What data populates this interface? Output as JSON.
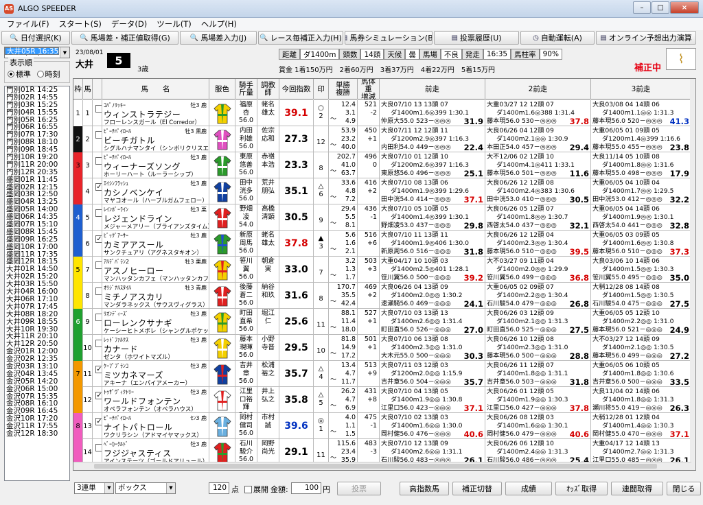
{
  "window": {
    "title": "ALGO SPEEDER",
    "controls": [
      "–",
      "□",
      "×"
    ]
  },
  "menu": [
    "ファイル(F)",
    "スタート(S)",
    "データ(D)",
    "ツール(T)",
    "ヘルプ(H)"
  ],
  "toolbar": [
    {
      "label": "日付選択(K)",
      "icon": "magnifier-icon",
      "w": 100
    },
    {
      "label": "馬場差・補正値取得(G)",
      "icon": "magnifier-icon",
      "w": 156
    },
    {
      "label": "馬場差入力(J)",
      "icon": "magnifier-icon",
      "w": 112
    },
    {
      "label": "レース毎補正入力(H)",
      "icon": "magnifier-icon",
      "w": 124
    },
    {
      "label": "馬券シミュレーション(B)",
      "icon": "sheet-icon",
      "w": 128
    },
    {
      "label": "投票履歴(U)",
      "icon": "sheet-icon",
      "w": 124
    },
    {
      "label": "自動運転(A)",
      "icon": "clock-icon",
      "w": 108
    },
    {
      "label": "オンライン予想出力演算",
      "icon": "sheet-icon",
      "w": 146
    }
  ],
  "left": {
    "date": "2023/08/01",
    "order_label": "表示順",
    "order_options": [
      "標準",
      "時刻"
    ],
    "order_selected": 0,
    "races": [
      "門別01R 14:25",
      "門別02R 14:55",
      "門別03R 15:25",
      "門別04R 15:55",
      "門別05R 16:25",
      "門別06R 16:55",
      "門別07R 17:30",
      "門別08R 18:10",
      "門別09R 18:45",
      "門別10R 19:20",
      "門別11R 20:00",
      "門別12R 20:35",
      "盛岡01R 11:45",
      "盛岡02R 12:15",
      "盛岡03R 12:50",
      "盛岡04R 13:25",
      "盛岡05R 14:00",
      "盛岡06R 14:35",
      "盛岡07R 15:10",
      "盛岡08R 15:45",
      "盛岡09R 16:25",
      "盛岡10R 17:00",
      "盛岡11R 17:35",
      "盛岡12R 18:15",
      "大井01R 14:50",
      "大井02R 15:20",
      "大井03R 15:50",
      "大井04R 16:00",
      "大井05R 16:35",
      "大井06R 17:10",
      "大井07R 17:45",
      "大井08R 18:20",
      "大井09R 18:55",
      "大井10R 19:30",
      "大井11R 20:10",
      "大井12R 20:50",
      "金沢01R 12:00",
      "金沢02R 12:35",
      "金沢03R 13:10",
      "金沢04R 13:45",
      "金沢05R 14:20",
      "金沢06R 15:00",
      "金沢07R 15:35",
      "金沢08R 16:10",
      "金沢09R 16:45",
      "金沢10R 17:20",
      "金沢11R 17:55",
      "金沢12R 18:30"
    ],
    "selected_index": 28
  },
  "header": {
    "date": "23/08/01",
    "venue": "大井",
    "race_no": "5",
    "category": "3歳",
    "info": [
      [
        "距離",
        "lab"
      ],
      [
        "ダ1400m",
        ""
      ],
      [
        "頭数",
        "lab"
      ],
      [
        "14頭",
        ""
      ],
      [
        "天候",
        "lab"
      ],
      [
        "曇",
        ""
      ],
      [
        "馬場",
        "lab"
      ],
      [
        "不良",
        ""
      ],
      [
        "発走",
        "lab"
      ],
      [
        "16:35",
        ""
      ],
      [
        "馬柱率",
        "lab"
      ],
      [
        "90%",
        ""
      ]
    ],
    "prizes": "賞金 1着150万円　2着60万円　3着37万円　4着22万円　5着15万円",
    "status": "補正中"
  },
  "columns": [
    "枠",
    "馬",
    "",
    "馬　　名",
    "服色",
    "騎手\n斤量",
    "調教\n師",
    "今回指数",
    "印",
    "単勝\n複勝",
    "馬体重\n増減",
    "前走",
    "2前走",
    "3前走"
  ],
  "waku_colors": [
    "#ffffff",
    "#111111",
    "#e8242a",
    "#e8242a",
    "#1f5fcf",
    "#1f5fcf",
    "#ffe500",
    "#ffe500",
    "#20a030",
    "#20a030",
    "#f39800",
    "#f39800",
    "#f05cbe",
    "#f05cbe"
  ],
  "waku_text_colors": [
    "#000",
    "#fff",
    "#000",
    "#000",
    "#fff",
    "#fff",
    "#000",
    "#000",
    "#fff",
    "#fff",
    "#000",
    "#000",
    "#000",
    "#000"
  ],
  "waku_labels": [
    "1",
    "2",
    "3",
    "",
    "4",
    "",
    "5",
    "",
    "6",
    "",
    "7",
    "",
    "8",
    ""
  ],
  "horses": [
    {
      "no": "1",
      "chk": false,
      "sire": "ｺﾊﾟﾉﾘｯｷｰ",
      "sex": "牡3 鹿",
      "name": "ウィンストラテジー",
      "dam": "フローレンスガール（El Corredor）",
      "jockey": "福原\n杏\n56.0",
      "trainer": "蛯名\n雄太",
      "index": "39.1",
      "index_color": "red",
      "mark": "○\n2",
      "odds": "12.4\n3.1\n4.9",
      "wt": "521\n-2",
      "p1": [
        "大良07/10 13 13頭 07",
        "ダ1400m1.6◎399 1:30.1",
        "仲原大55.0 523－◎◎◎ 31.9"
      ],
      "p2": [
        "大重03/27 12 12頭 07",
        "ダ1400m1.6◎388 1:31.4",
        "藤本現56.0 530－◎◎◎ 37.8"
      ],
      "p3": [
        "大良03/08 04 14頭 06",
        "ダ1400m1.1◎◎ 1:31.3",
        "藤本現56.0 520－◎◎◎ 41.3"
      ],
      "p2c": "red",
      "p3c": "blue"
    },
    {
      "no": "2",
      "chk": false,
      "sire": "ﾋﾟｰﾁﾊﾟｲﾛｰﾙ",
      "sex": "牡3 黒鹿",
      "name": "ビーチガトル",
      "dam": "シグルハナマンタイ（シンボリクリスエス）",
      "jockey": "内田\n利雄\n56.0",
      "trainer": "佐宗\n応和",
      "index": "27.3",
      "index_color": "",
      "mark": "\n12",
      "odds": "53.9\n23.2\n40.0",
      "wt": "450\n+1",
      "p1": [
        "大良07/11 12 12頭 11",
        "ダ1200m2.9◎397 1:16.3",
        "内田利54.0 449－◎◎◎ 22.4"
      ],
      "p2": [
        "大良06/26 04 12頭 09",
        "ダ1400m2.1◎◎ 1:30.9",
        "本田正54.0 457－◎◎◎ 29.4"
      ],
      "p3": [
        "大重06/05 01 09頭 05",
        "ダ1200m1.4◎399 1:16.6",
        "藤本現55.0 455－◎◎◎ 23.8"
      ],
      "p2c": "",
      "p3c": ""
    },
    {
      "no": "3",
      "chk": false,
      "sire": "ﾋﾟｰﾁﾊﾟｲﾛｰﾙ",
      "sex": "牡3 鹿",
      "name": "ウィーナーズソング",
      "dam": "ホーリーハート（ルーラーシップ）",
      "jockey": "東原\n悠善\n56.0",
      "trainer": "赤嶺\n本浩",
      "index": "23.3",
      "index_color": "",
      "mark": "\n8",
      "odds": "202.7\n41.0\n63.7",
      "wt": "496\n0",
      "p1": [
        "大良07/10 01 12頭 10",
        "ダ1200m2.6◎397 1:16.3",
        "東原悠56.0 496－◎◎◎ 25.1"
      ],
      "p2": [
        "大不12/06 02 12頭 10",
        "ダ1400m4.1◎411 1:33.1",
        "藤本現56.0 501－◎◎◎ 11.6"
      ],
      "p3": [
        "大良11/14 05 10頭 08",
        "ダ1400m1.8◎◎ 1:31.6",
        "藤本現55.0 498－◎◎◎ 17.9"
      ],
      "p2c": "",
      "p3c": ""
    },
    {
      "no": "4",
      "chk": true,
      "sire": "ｴｲｼﾝﾌﾗｯｼｭ",
      "sex": "牡3 鹿",
      "name": "カシノベンケイ",
      "dam": "マヤコオール（ハーブルガムフェロー）",
      "jockey": "田中\n洸多\n56.0",
      "trainer": "荒井\n朋弘",
      "index": "35.1",
      "index_color": "",
      "mark": "△\n6",
      "odds": "33.6\n4.8\n7.2",
      "wt": "416\n+2",
      "p1": [
        "大良07/10 08 13頭 06",
        "ダ1400m1.9◎399 1:29.6",
        "田中洸54.0 414－◎◎◎ 37.1"
      ],
      "p2": [
        "大良06/26 12 12頭 08",
        "ダ1400m2.4◎383 1:30.6",
        "田中洸53.0 410－◎◎◎ 30.5"
      ],
      "p3": [
        "大重06/05 04 10頭 04",
        "ダ1400m1.7◎◎ 1:29.5",
        "田中洸53.0 412－◎◎◎ 32.2"
      ],
      "p1c": "red",
      "p2c": "",
      "p3c": ""
    },
    {
      "no": "5",
      "chk": false,
      "sire": "ﾚｲﾝﾎﾞｰﾗｲﾝ",
      "sex": "牡3 栗",
      "name": "レジェンドライン",
      "dam": "メジャーメアリー（ブライアンズタイム）",
      "jockey": "野畑\n凌\n54.0",
      "trainer": "高橋\n清顕",
      "index": "30.5",
      "index_color": "",
      "mark": "\n9",
      "odds": "29.4\n5.5\n8.1",
      "wt": "436\n-1",
      "p1": [
        "大良07/10 05 10頭 05",
        "ダ1400m1.4◎399 1:30.1",
        "野畑凌53.0 437－◎◎◎ 29.8"
      ],
      "p2": [
        "大良06/26 05 12頭 07",
        "ダ1400m1.8◎◎ 1:30.7",
        "西啓太54.0 437－◎◎◎ 32.1"
      ],
      "p3": [
        "大重06/05 04 14頭 06",
        "ダ1400m1.9◎◎ 1:30.1",
        "西啓太54.0 441－◎◎◎ 32.8"
      ],
      "p2c": "",
      "p3c": ""
    },
    {
      "no": "6",
      "chk": true,
      "sire": "ﾋﾞｯｸﾞｱｰｻｰ",
      "sex": "牡3 鹿",
      "name": "カミアアスール",
      "dam": "サンクチュアリ（アグネスタキオン）",
      "jockey": "新原\n周馬\n56.0",
      "trainer": "蛯名\n雄太",
      "index": "37.8",
      "index_color": "red",
      "mark": "▲\n3",
      "odds": "5.6\n1.6\n2.1",
      "wt": "516\n+6",
      "p1": [
        "大良07/10 11 13頭 11",
        "ダ1400m1.9◎406 1:30.0",
        "新原周56.0 516－◎◎◎ 31.8"
      ],
      "p2": [
        "大良06/26 12 12頭 04",
        "ダ1400m2.3◎◎ 1:30.4",
        "藤本現56.0 510－◎◎◎ 39.5"
      ],
      "p3": [
        "大重06/05 03 09頭 05",
        "ダ1400m1.6◎◎ 1:30.8",
        "藤本現56.0 510－◎◎◎ 37.3"
      ],
      "p2c": "red",
      "p3c": "red"
    },
    {
      "no": "7",
      "chk": false,
      "sire": "ｱﾙﾃﾞﾊﾞﾗﾝ2",
      "sex": "牡3 栗鹿",
      "name": "アスノヒーロー",
      "dam": "マンハッタンカフェ（マンハッタンカフェ）",
      "jockey": "笹川\n翼\n56.0",
      "trainer": "朝倉\n実",
      "index": "33.0",
      "index_color": "",
      "mark": "\n7",
      "odds": "3.2\n1.3\n1.7",
      "wt": "503\n+3",
      "p1": [
        "大重04/17 10 10頭 03",
        "ダ1400m2.5◎401 1:28.1",
        "笹川翼56.0 500－◎◎◎ 39.2"
      ],
      "p2": [
        "大不03/27 09 11頭 04",
        "ダ1400m2.0◎◎ 1:29.9",
        "笹川翼56.0 499－◎◎◎ 36.8"
      ],
      "p3": [
        "大良03/06 10 14頭 06",
        "ダ1400m1.5◎◎ 1:30.3",
        "笹川翼55.0 495－◎◎◎ 35.0"
      ],
      "p1c": "red",
      "p2c": "red",
      "p3c": ""
    },
    {
      "no": "8",
      "chk": false,
      "sire": "ｵﾘｼﾞﾅﾙｽﾀｲﾙ",
      "sex": "牡3 青鹿",
      "name": "ミチノアスカリ",
      "dam": "マンダラネックス（サウスヴィグラス）",
      "jockey": "後藤\n蒼二\n56.0",
      "trainer": "納谷\n和玖",
      "index": "31.6",
      "index_color": "",
      "mark": "\n8",
      "odds": "170.7\n35.5\n42.4",
      "wt": "469\n+2",
      "p1": [
        "大良06/26 04 13頭 09",
        "ダ1400m2.0◎◎ 1:30.2",
        "速瀬騎56.0 469－◎◎◎ 24.1"
      ],
      "p2": [
        "大重06/05 02 09頭 07",
        "ダ1400m2.2◎◎ 1:30.4",
        "石川駿54.0 479－◎◎◎ 26.8"
      ],
      "p3": [
        "大稍12/28 08 14頭 08",
        "ダ1400m1.5◎◎ 1:30.5",
        "石川駿54.0 475－◎◎◎ 27.5"
      ],
      "p2c": "",
      "p3c": ""
    },
    {
      "no": "9",
      "chk": false,
      "sire": "ﾘｵﾝﾃﾞｨｰｽﾞ",
      "sex": "牡3 鹿",
      "name": "ローレンクサナギ",
      "dam": "ケーシーヒトメボレ（シャングルポケット）",
      "jockey": "町田\n直希\n56.0",
      "trainer": "堀江\n仁",
      "index": "25.6",
      "index_color": "",
      "mark": "\n11",
      "odds": "88.1\n11.4\n18.0",
      "wt": "527\n+1",
      "p1": [
        "大良07/10 03 13頭 13",
        "ダ1400m2.6◎◎ 1:31.4",
        "町田直56.0 526－◎◎◎ 27.0"
      ],
      "p2": [
        "大良06/26 03 12頭 09",
        "ダ1400m2.1◎◎ 1:31.3",
        "町田直56.0 525－◎◎◎ 27.5"
      ],
      "p3": [
        "大重06/05 05 12頭 10",
        "ダ1400m2.2◎◎ 1:31.0",
        "藤本現56.0 521－◎◎◎ 24.9"
      ],
      "p2c": "",
      "p3c": ""
    },
    {
      "no": "10",
      "chk": false,
      "sire": "ﾚｯﾄﾞﾌｧﾙｸｽ",
      "sex": "牡3 鹿",
      "name": "カナード",
      "dam": "ゼンタ（ホワイトマズル）",
      "jockey": "藤本\n現暉\n56.0",
      "trainer": "小野\n寺晋",
      "index": "29.5",
      "index_color": "",
      "mark": "\n10",
      "odds": "81.8\n14.9\n17.2",
      "wt": "501\n+1",
      "p1": [
        "大良07/10 06 13頭 08",
        "ダ1400m2.3◎◎ 1:31.0",
        "大木元55.0 500－◎◎◎ 30.3"
      ],
      "p2": [
        "大良06/26 10 12頭 08",
        "ダ1400m2.3◎◎ 1:31.0",
        "藤本現56.0 500－◎◎◎ 28.8"
      ],
      "p3": [
        "大不03/27 12 14頭 09",
        "ダ1400m2.1◎◎ 1:30.5",
        "藤本現56.0 499－◎◎◎ 27.2"
      ],
      "p2c": "",
      "p3c": ""
    },
    {
      "no": "11",
      "chk": true,
      "sire": "ｹｰﾌﾟﾌﾞﾗﾝｺ",
      "sex": "牡3 鹿",
      "name": "ミツカネマーズ",
      "dam": "アキーナ（エンパイアメーカー）",
      "jockey": "吉井\n章\n56.0",
      "trainer": "松浦\n裕之",
      "index": "35.7",
      "index_color": "",
      "mark": "△\n4",
      "odds": "13.4\n4.7\n11.7",
      "wt": "513\n+9",
      "p1": [
        "大良07/11 03 12頭 03",
        "ダ1200m2.0◎◎ 1:15.9",
        "吉井章56.0 504－◎◎◎ 35.7"
      ],
      "p2": [
        "大良06/26 11 12頭 07",
        "ダ1400m1.8◎◎ 1:31.1",
        "吉井章56.0 503－◎◎◎ 31.8"
      ],
      "p3": [
        "大重06/05 06 10頭 05",
        "ダ1400m1.8◎◎ 1:30.6",
        "吉井章56.0 500－◎◎◎ 33.5"
      ],
      "p2c": "",
      "p3c": ""
    },
    {
      "no": "12",
      "chk": true,
      "sire": "ﾄｩｻﾞｳﾞｨｸﾄﾘｰ",
      "sex": "牡3 鹿",
      "name": "ワールドフォンテン",
      "dam": "オペラフォンテン（オペラハウス）",
      "jockey": "江里\n口裕\n輝\n56.0",
      "trainer": "井上\n弘之",
      "index": "35.8",
      "index_color": "",
      "mark": "△\n5",
      "odds": "26.2\n4.7\n6.9",
      "wt": "431\n+8",
      "p1": [
        "大良07/10 04 13頭 05",
        "ダ1400m1.9◎◎ 1:30.8",
        "江里口56.0 423－◎◎◎ 37.1"
      ],
      "p2": [
        "大良06/26 01 12頭 05",
        "ダ1400m1.9◎◎ 1:30.3",
        "江里口56.0 427－◎◎◎ 37.8"
      ],
      "p3": [
        "大良11/04 02 14頭 06",
        "ダ1400m1.8◎◎ 1:31.3",
        "瀬川将55.0 419－◎◎◎ 26.3"
      ],
      "p1c": "red",
      "p2c": "red",
      "p3c": ""
    },
    {
      "no": "13",
      "chk": true,
      "sire": "ﾋﾟｰﾁﾊﾟｲﾛｰﾙ",
      "sex": "ｾﾝ3 鹿",
      "name": "ナイトパトロール",
      "dam": "ワクリラシン（アドマイヤマックス）",
      "jockey": "岡村\n健司\n56.0",
      "trainer": "市村\n誠",
      "index": "39.6",
      "index_color": "blue",
      "mark": "◎\n1",
      "odds": "4.0\n1.1\n1.5",
      "wt": "475\n-1",
      "p1": [
        "大良07/10 02 13頭 03",
        "ダ1400m1.6◎◎ 1:30.0",
        "岡村健56.0 476－◎◎◎ 40.6"
      ],
      "p2": [
        "大良06/26 08 12頭 03",
        "ダ1400m1.6◎◎ 1:30.1",
        "岡村健56.0 479－◎◎◎ 40.6"
      ],
      "p3": [
        "大稍12/28 01 12頭 04",
        "ダ1400m1.4◎◎ 1:30.3",
        "岡村健55.0 470－◎◎◎ 37.1"
      ],
      "p1c": "red",
      "p2c": "red",
      "p3c": "red"
    },
    {
      "no": "14",
      "chk": false,
      "sire": "ﾍﾞｰｶｰｸﾙﾄﾞ",
      "sex": "牡3 鹿",
      "name": "フジジャスティス",
      "dam": "アインステーツ（ゴールドアリュール）",
      "jockey": "石川\n駿介\n56.0",
      "trainer": "岡野\n尚光",
      "index": "29.1",
      "index_color": "",
      "mark": "\n11",
      "odds": "115.6\n23.4\n35.9",
      "wt": "483\n-3",
      "p1": [
        "大良07/10 12 13頭 09",
        "ダ1400m2.6◎◎ 1:31.1",
        "石川駿56.0 483－◎◎◎ 26.1"
      ],
      "p2": [
        "大良06/26 06 12頭 10",
        "ダ1400m2.4◎◎ 1:31.3",
        "石川駿56.0 486－◎◎◎ 25.4"
      ],
      "p3": [
        "大重04/17 12 14頭 13",
        "ダ1400m2.7◎◎ 1:31.3",
        "江里口55.0 485－◎◎◎ 26.1"
      ],
      "p2c": "",
      "p3c": ""
    }
  ],
  "bottom": {
    "bet_type": "3連単",
    "bet_mode": "ボックス",
    "points": "120",
    "points_unit": "点",
    "expand_label": "展開",
    "amount_label": "金額:",
    "amount": "100",
    "amount_unit": "円",
    "buttons": [
      "投票",
      "高指数馬",
      "補正切替",
      "成績",
      "ｵｯｽﾞ取得",
      "連闘取得",
      "閉じる"
    ]
  }
}
